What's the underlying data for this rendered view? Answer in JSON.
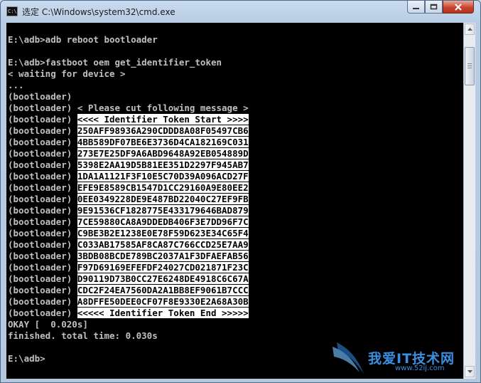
{
  "window": {
    "title": "选定 C:\\Windows\\system32\\cmd.exe",
    "app_icon_text": "C:\\"
  },
  "console": {
    "lines": [
      {
        "text": "E:\\adb>adb reboot bootloader"
      },
      {
        "text": "E:\\adb>fastboot oem get_identifier_token"
      },
      {
        "text": "< waiting for device >"
      },
      {
        "text": "..."
      },
      {
        "text": "(bootloader)"
      },
      {
        "prefix": "(bootloader) ",
        "text": "< Please cut following message >"
      },
      {
        "prefix": "(bootloader) ",
        "text": "<<<< Identifier Token Start >>>>",
        "selected": true
      },
      {
        "prefix": "(bootloader) ",
        "text": "250AFF98936A290CDDD8A08F05497CB6",
        "selected": true
      },
      {
        "prefix": "(bootloader) ",
        "text": "4BB589DF07BE6E3736D4CA182169C031",
        "selected": true
      },
      {
        "prefix": "(bootloader) ",
        "text": "273E7E25DF9A6ABD9648A92EB054889D",
        "selected": true
      },
      {
        "prefix": "(bootloader) ",
        "text": "5398E2AA19D5B81EE351D2297F945AB7",
        "selected": true
      },
      {
        "prefix": "(bootloader) ",
        "text": "1DA1A1121F3F10E5C70D39A096ACD27F",
        "selected": true
      },
      {
        "prefix": "(bootloader) ",
        "text": "EFE9E8589CB1547D1CC29160A9E80EE2",
        "selected": true
      },
      {
        "prefix": "(bootloader) ",
        "text": "0EE0349228DE9E487BD22040C27EF9FB",
        "selected": true
      },
      {
        "prefix": "(bootloader) ",
        "text": "9E91536CF1828775E433179646BAD879",
        "selected": true
      },
      {
        "prefix": "(bootloader) ",
        "text": "7CE59880CA8A9DDEDB406F3E7DD96F7C",
        "selected": true
      },
      {
        "prefix": "(bootloader) ",
        "text": "C9BE3B2E1238E0E78F59D623E34C65F4",
        "selected": true
      },
      {
        "prefix": "(bootloader) ",
        "text": "C033AB17585AF8CA87C766CCD25E7AA9",
        "selected": true
      },
      {
        "prefix": "(bootloader) ",
        "text": "3BDB08BCDE789BC2037A1F3DFAEFAB56",
        "selected": true
      },
      {
        "prefix": "(bootloader) ",
        "text": "F97D69169EFEFDF24027CD021871F23C",
        "selected": true
      },
      {
        "prefix": "(bootloader) ",
        "text": "D90119D73B0CC27E6248DE4918C6C67A",
        "selected": true
      },
      {
        "prefix": "(bootloader) ",
        "text": "CDC2F24EA7560DA2A1BB8EF9061B7CCC",
        "selected": true
      },
      {
        "prefix": "(bootloader) ",
        "text": "A8DFFE50DEE0CF07F8E9330E2A68A30B",
        "selected": true
      },
      {
        "prefix": "(bootloader) ",
        "text": "<<<<< Identifier Token End >>>>>",
        "selected": true
      },
      {
        "text": "OKAY [  0.020s]"
      },
      {
        "text": "finished. total time: 0.030s"
      },
      {
        "text": "E:\\adb>"
      }
    ]
  },
  "watermark": {
    "text": "我爱IT技术网",
    "url": "www.52ij.com"
  },
  "colors": {
    "console_bg": "#000000",
    "console_text": "#c0c0c0",
    "selection_bg": "#ffffff",
    "selection_text": "#000000"
  }
}
